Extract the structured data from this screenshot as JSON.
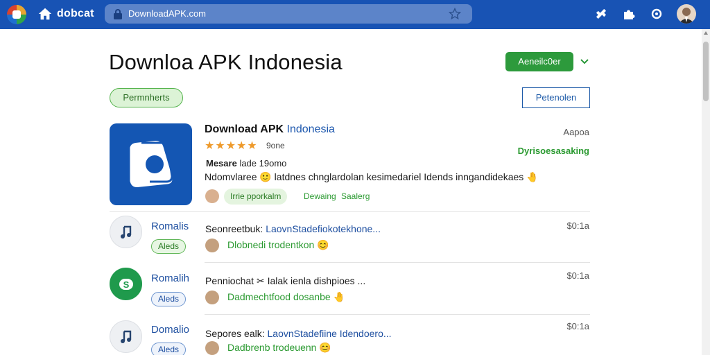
{
  "topbar": {
    "brand": "dobcat",
    "url": "DownloadAPK.com",
    "icons": [
      "app-logo",
      "home-icon",
      "lock-icon",
      "star-icon",
      "extension-icon",
      "puzzle-icon",
      "sync-icon",
      "user-avatar"
    ]
  },
  "header": {
    "title": "Downloa APK Indonesia",
    "primary_button": "Aeneilc0er",
    "filter_pill": "Permnherts",
    "outline_button": "Petenolen"
  },
  "featured": {
    "title": "Download APK",
    "title_accent": "Indonesia",
    "stars": "★★★★★",
    "rating_text": "9one",
    "corner_label": "Aapoa",
    "corner_green": "Dyrisoesasaking",
    "meta_label": "Mesare",
    "meta_value": "lade 19omo",
    "description": "Ndomvlaree 🙂 latdnes chnglardolan kesimedariel Idends inngandidekaes 🤚",
    "tag": "Irrie pporkalm",
    "link_1": "Dewaing",
    "link_2": "Saalerg"
  },
  "list": [
    {
      "name": "Romalis",
      "badge": "Aleds",
      "badge_style": "green",
      "text_prefix": "Seonreetbuk:",
      "text_link": "LaovnStadefiokotekhone...",
      "sub": "Dlobnedi trodentkon 😊",
      "time": "$0:1a",
      "icon": "music-note-icon"
    },
    {
      "name": "Romalih",
      "badge": "Aleds",
      "badge_style": "blue",
      "text_prefix": "Penniochat ✂ Ialak ienla dishpioes ...",
      "text_link": "",
      "sub": "Dadmechtfood dosanbe 🤚",
      "time": "$0:1a",
      "icon": "s-logo-icon"
    },
    {
      "name": "Domalio",
      "badge": "Aleds",
      "badge_style": "blue",
      "text_prefix": "Sepores ealk:",
      "text_link": "LaovnStadefiine Idendoero...",
      "sub": "Dadbrenb trodeuenn 😊",
      "time": "$0:1a",
      "icon": "music-note-icon"
    }
  ],
  "colors": {
    "topbar": "#1853b4",
    "accent_blue": "#1e4fa0",
    "accent_green": "#2d9a3c",
    "star": "#ee9a2b"
  }
}
